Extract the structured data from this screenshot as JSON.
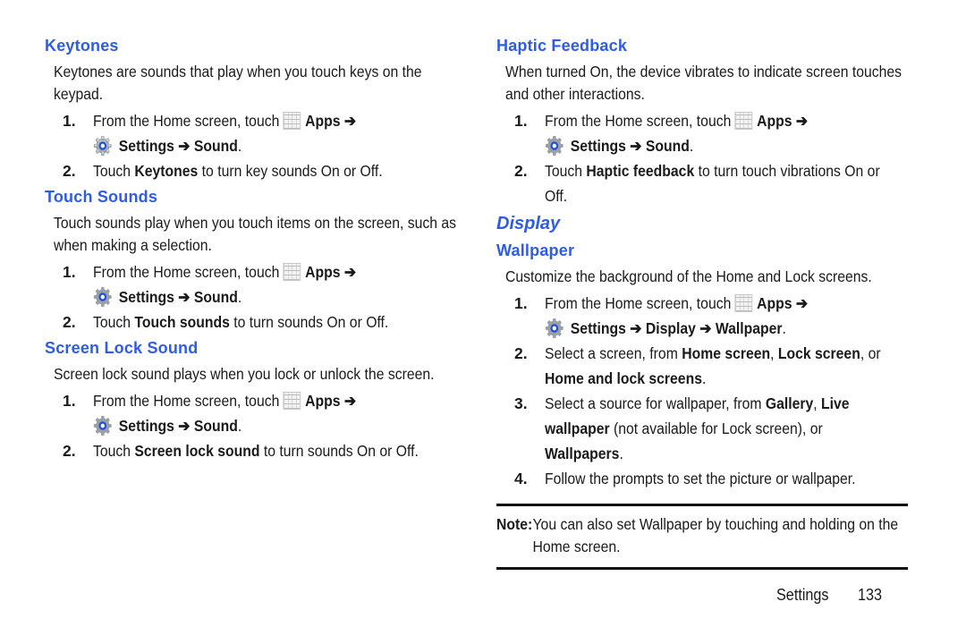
{
  "page": {
    "left_column": {
      "keytones": {
        "heading": "Keytones",
        "description": "Keytones are sounds that play when you touch keys on the keypad.",
        "step1": {
          "num": "1.",
          "prefix": "From the Home screen, touch",
          "apps": "Apps ➔",
          "path": "Settings ➔ Sound",
          "end": "."
        },
        "step2": {
          "num": "2.",
          "pre": "Touch ",
          "bold": "Keytones",
          "post": " to turn key sounds On or Off."
        }
      },
      "touch_sounds": {
        "heading": "Touch Sounds",
        "description": "Touch sounds play when you touch items on the screen, such as when making a selection.",
        "step1": {
          "num": "1.",
          "prefix": "From the Home screen, touch",
          "apps": "Apps ➔",
          "path": "Settings ➔ Sound",
          "end": "."
        },
        "step2": {
          "num": "2.",
          "pre": "Touch ",
          "bold": "Touch sounds",
          "post": " to turn sounds On or Off."
        }
      },
      "screen_lock_sound": {
        "heading": "Screen Lock Sound",
        "description": "Screen lock sound plays when you lock or unlock the screen.",
        "step1": {
          "num": "1.",
          "prefix": "From the Home screen, touch",
          "apps": "Apps ➔",
          "path": "Settings ➔ Sound",
          "end": "."
        },
        "step2": {
          "num": "2.",
          "pre": "Touch ",
          "bold": "Screen lock sound",
          "post": " to turn sounds On or Off."
        }
      }
    },
    "right_column": {
      "haptic": {
        "heading": "Haptic Feedback",
        "description": "When turned On, the device vibrates to indicate screen touches and other interactions.",
        "step1": {
          "num": "1.",
          "prefix": "From the Home screen, touch",
          "apps": "Apps ➔",
          "path": "Settings ➔ Sound",
          "end": "."
        },
        "step2": {
          "num": "2.",
          "pre": "Touch ",
          "bold": "Haptic feedback",
          "post": " to turn touch vibrations On or Off."
        }
      },
      "display": {
        "heading": "Display",
        "wallpaper": {
          "heading": "Wallpaper",
          "description": "Customize the background of the Home and Lock screens.",
          "step1": {
            "num": "1.",
            "prefix": "From the Home screen, touch",
            "apps": "Apps ➔",
            "path": "Settings ➔ Display ➔ Wallpaper",
            "end": "."
          },
          "step2": {
            "num": "2.",
            "t1": "Select a screen, from ",
            "b1": "Home screen",
            "t2": ", ",
            "b2": "Lock screen",
            "t3": ", or ",
            "b3": "Home and lock screens",
            "t4": "."
          },
          "step3": {
            "num": "3.",
            "t1": "Select a source for wallpaper, from ",
            "b1": "Gallery",
            "t2": ", ",
            "b2": "Live wallpaper",
            "t3": " (not available for Lock screen), or ",
            "b3": "Wallpapers",
            "t4": "."
          },
          "step4": {
            "num": "4.",
            "text": "Follow the prompts to set the picture or wallpaper."
          }
        }
      },
      "note": {
        "label": "Note:",
        "text": "You can also set Wallpaper by touching and holding on the Home screen."
      }
    },
    "footer": {
      "section": "Settings",
      "page_number": "133"
    }
  }
}
